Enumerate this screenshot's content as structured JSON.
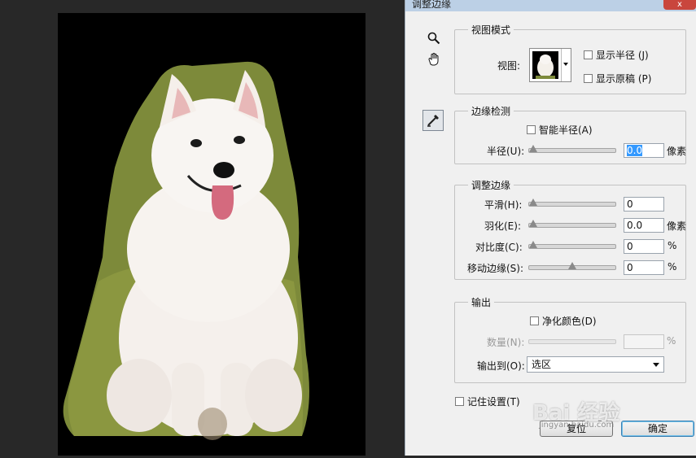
{
  "dialog": {
    "title": "调整边缘",
    "close_label": "x"
  },
  "tools": {
    "zoom_icon": "zoom-icon",
    "hand_icon": "hand-icon",
    "refine_icon": "refine-radius-brush-icon"
  },
  "view_mode": {
    "legend": "视图模式",
    "view_label": "视图:",
    "show_radius_label": "显示半径 (J)",
    "show_original_label": "显示原稿 (P)"
  },
  "edge_detection": {
    "legend": "边缘检测",
    "smart_radius_label": "智能半径(A)",
    "radius_label": "半径(U):",
    "radius_value": "0.0",
    "radius_unit": "像素",
    "radius_slider": 0
  },
  "adjust_edge": {
    "legend": "调整边缘",
    "smooth_label": "平滑(H):",
    "smooth_value": "0",
    "smooth_slider": 0,
    "feather_label": "羽化(E):",
    "feather_value": "0.0",
    "feather_unit": "像素",
    "feather_slider": 0,
    "contrast_label": "对比度(C):",
    "contrast_value": "0",
    "contrast_unit": "%",
    "contrast_slider": 0,
    "shift_label": "移动边缘(S):",
    "shift_value": "0",
    "shift_unit": "%",
    "shift_slider": 0.5
  },
  "output": {
    "legend": "输出",
    "decontaminate_label": "净化颜色(D)",
    "amount_label": "数量(N):",
    "amount_value": "",
    "amount_unit": "%",
    "output_to_label": "输出到(O):",
    "output_to_value": "选区"
  },
  "remember_label": "记住设置(T)",
  "buttons": {
    "reset": "复位",
    "ok": "确定"
  },
  "watermark": {
    "text": "Bai 经验",
    "sub": "jingyan.baidu.com"
  }
}
